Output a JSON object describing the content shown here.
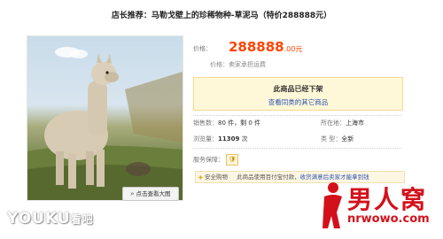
{
  "title": "店长推荐：马勒戈壁上的珍稀物种-草泥马（特价288888元）",
  "image": {
    "zoom_label": "点击查看大图"
  },
  "price": {
    "label": "价格：",
    "amount": "288888",
    "decimals": ".00元"
  },
  "orig_note": "价格：卖家承担运费",
  "notice": {
    "line1": "此商品已经下架",
    "line2": "查看同类的其它商品"
  },
  "stats": {
    "sales_label": "销售数：",
    "sales_value": "80 件，剩 0 件",
    "location_label": "所在地：",
    "location_value": "上海市",
    "views_label": "浏览量：",
    "views_value": "11309",
    "views_unit": " 次",
    "type_label": "类   型：",
    "type_value": "全新"
  },
  "guarantee": {
    "label": "服务保障：",
    "safe_label": "安全购物",
    "desc": "此商品使用百付宝付款，",
    "link": "收货满意后卖家才能拿到钱"
  },
  "watermarks": {
    "youku": "YOUKU",
    "youku_sub": "看吧",
    "site_cn": "男人窝",
    "site_url": "nrwowo.com"
  },
  "colors": {
    "price": "#ff4400",
    "link": "#2a54b0",
    "notice_bg": "#fff8d8",
    "brand_red": "#d3111b"
  }
}
